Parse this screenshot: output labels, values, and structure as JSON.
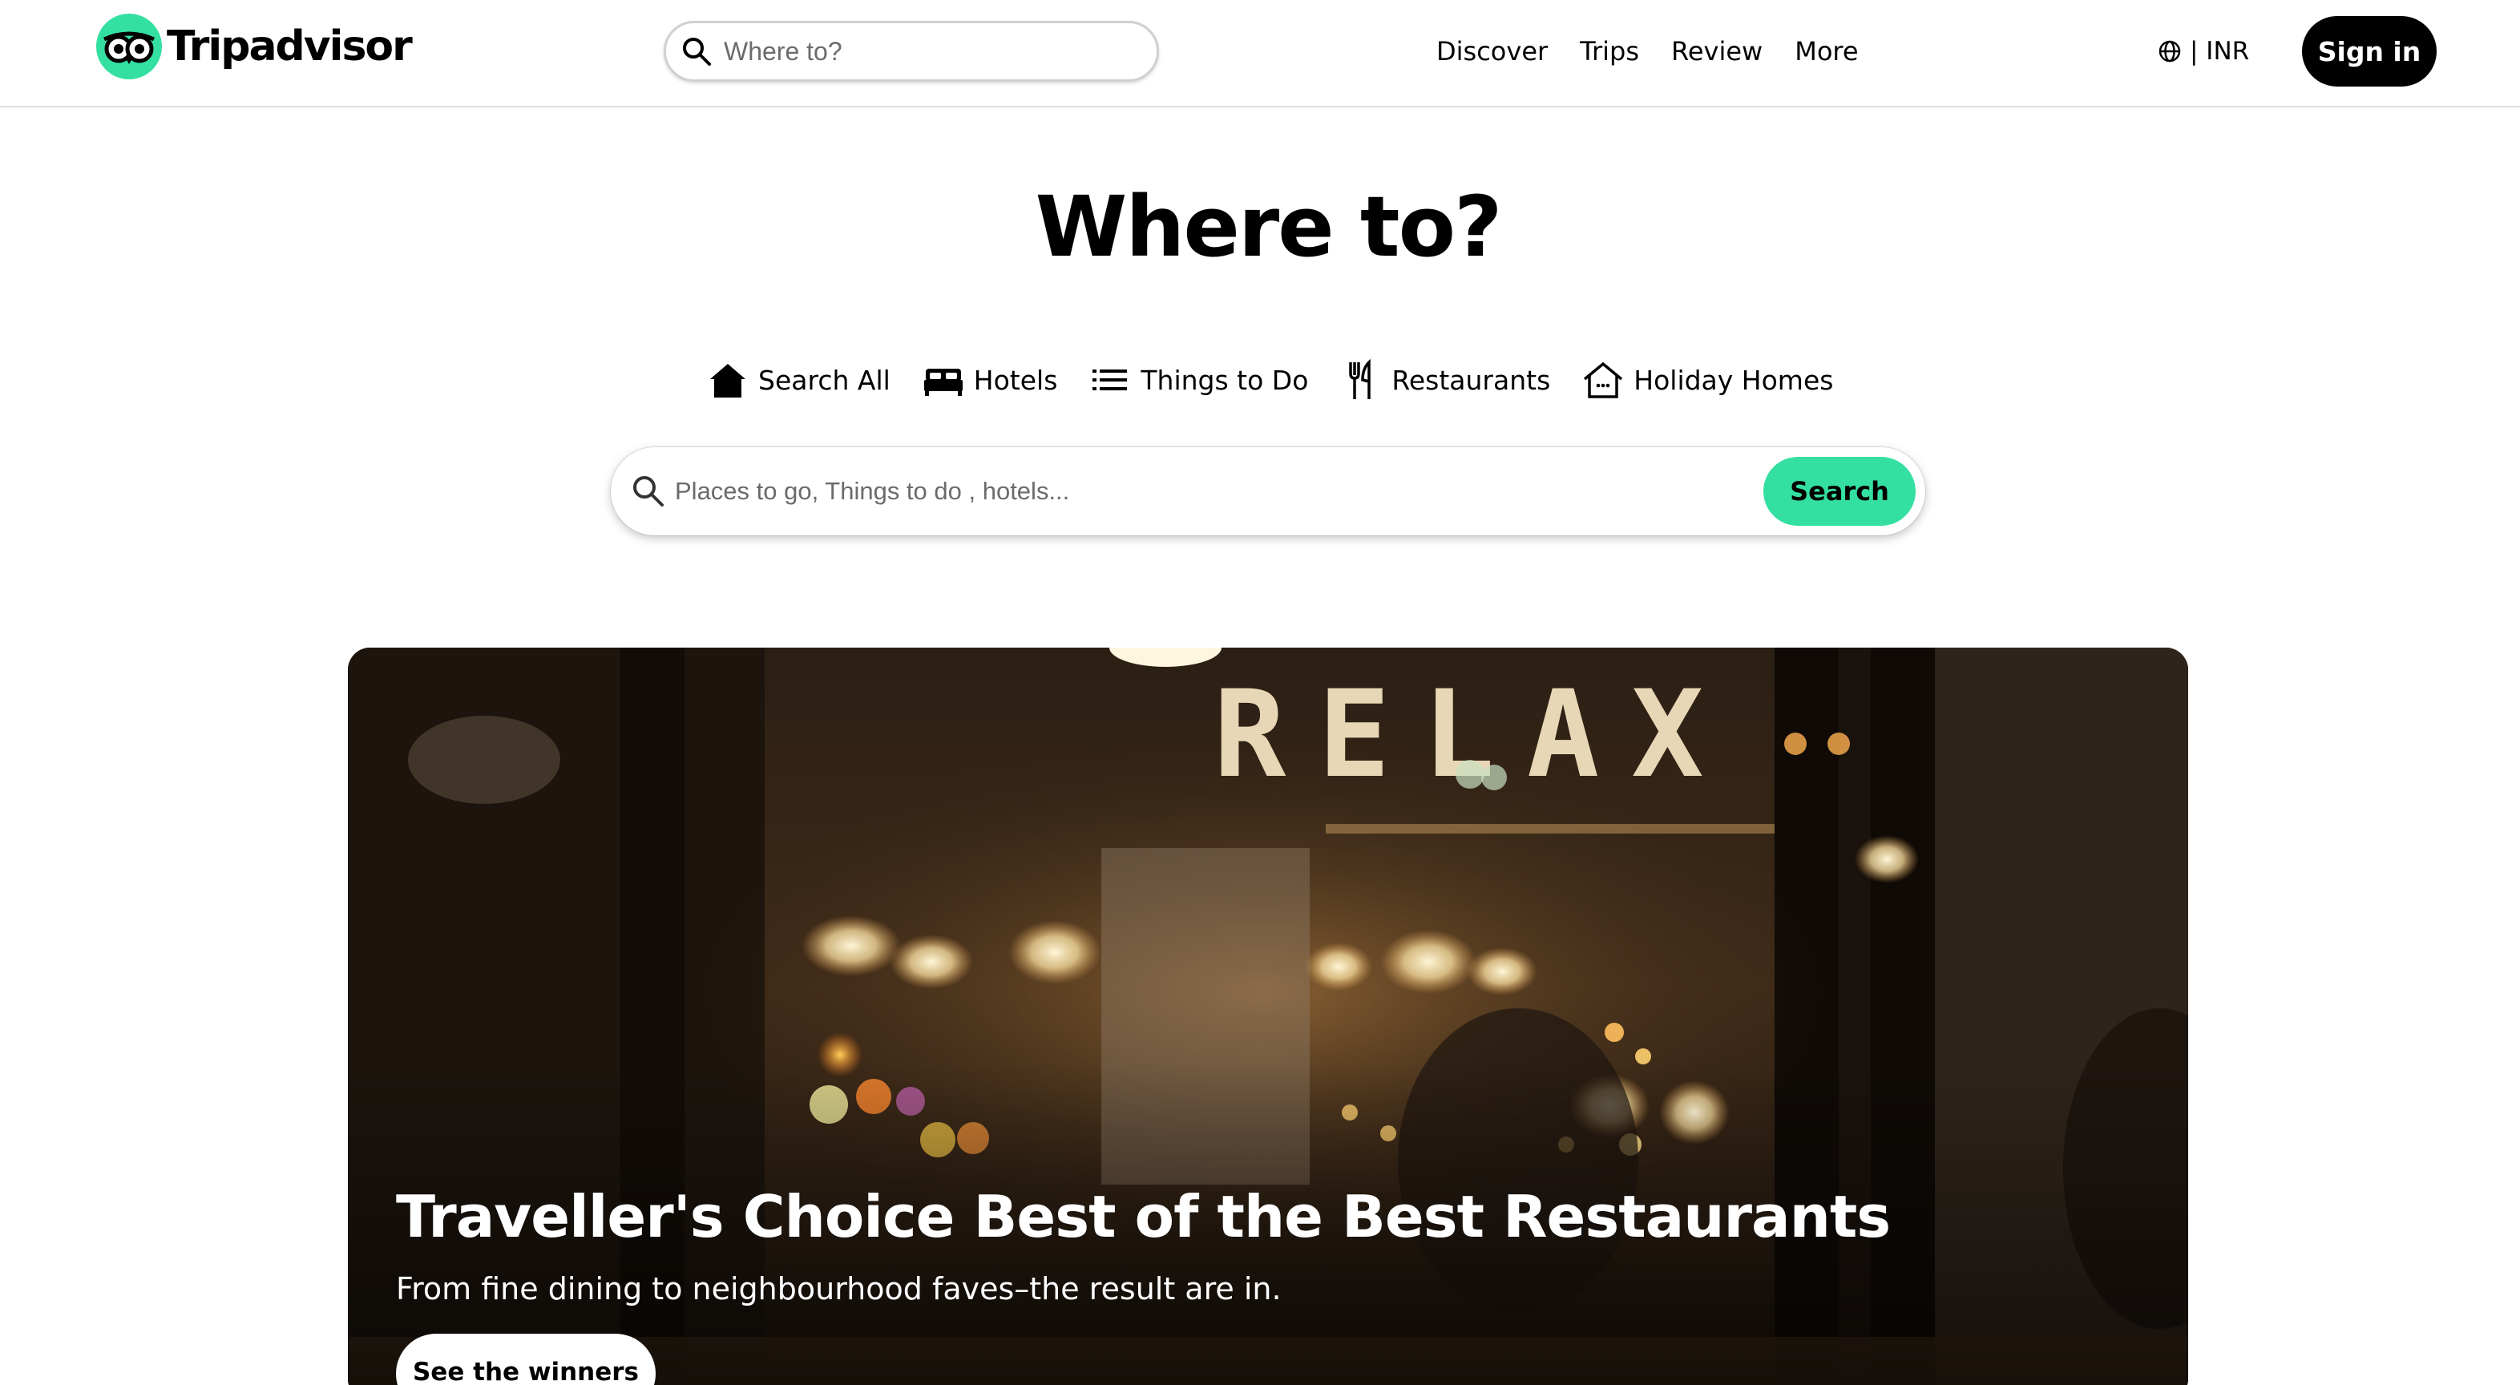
{
  "header": {
    "brand": "Tripadvisor",
    "search_placeholder": "Where to?",
    "nav": [
      "Discover",
      "Trips",
      "Review",
      "More"
    ],
    "currency": "| INR",
    "signin_label": "Sign in"
  },
  "hero": {
    "title": "Where to?",
    "tabs": [
      {
        "label": "Search All",
        "icon": "house-icon"
      },
      {
        "label": "Hotels",
        "icon": "bed-icon"
      },
      {
        "label": "Things to Do",
        "icon": "list-icon"
      },
      {
        "label": "Restaurants",
        "icon": "fork-knife-icon"
      },
      {
        "label": "Holiday Homes",
        "icon": "home-outline-icon"
      }
    ],
    "search_placeholder": "Places to go, Things to do , hotels...",
    "search_button": "Search"
  },
  "banner": {
    "title": "Traveller's Choice Best of the Best Restaurants",
    "subtitle": "From fine dining to neighbourhood faves–the result are in.",
    "button": "See the winners",
    "sign_text": "RELAX"
  },
  "colors": {
    "accent": "#34e0a1",
    "button_dark": "#000000",
    "border": "#e0e0e0"
  }
}
